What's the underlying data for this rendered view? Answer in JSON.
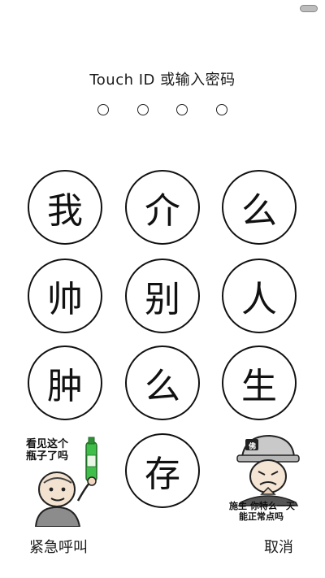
{
  "status_bar": {
    "battery_icon": "battery-icon"
  },
  "passcode": {
    "title": "Touch ID 或输入密码",
    "digits_entered": 0,
    "digits_total": 4
  },
  "keypad": {
    "keys": [
      "我",
      "介",
      "么",
      "帅",
      "别",
      "人",
      "肿",
      "么",
      "生",
      "存"
    ]
  },
  "stickers": {
    "left": {
      "caption_line1": "看见这个",
      "caption_line2": "瓶子了吗"
    },
    "right": {
      "hat_text": "佛",
      "caption_line1": "施主 你特么一天",
      "caption_line2": "能正常点吗"
    }
  },
  "bottom_bar": {
    "emergency_label": "紧急呼叫",
    "cancel_label": "取消"
  }
}
